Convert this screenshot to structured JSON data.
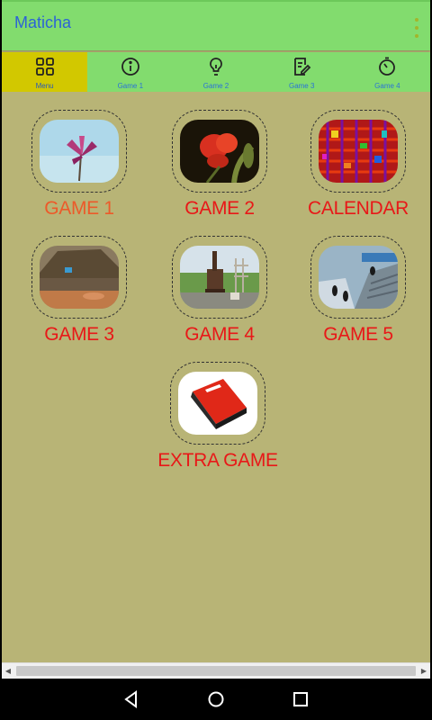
{
  "app": {
    "title": "Maticha"
  },
  "tabs": [
    {
      "label": "Menu",
      "icon": "grid-icon",
      "active": true
    },
    {
      "label": "Game 1",
      "icon": "info-icon",
      "active": false
    },
    {
      "label": "Game 2",
      "icon": "lightbulb-icon",
      "active": false
    },
    {
      "label": "Game 3",
      "icon": "edit-note-icon",
      "active": false
    },
    {
      "label": "Game 4",
      "icon": "timer-icon",
      "active": false
    }
  ],
  "tiles": [
    {
      "label": "GAME 1",
      "image": "purple-flower-image"
    },
    {
      "label": "GAME 2",
      "image": "red-flower-image"
    },
    {
      "label": "CALENDAR",
      "image": "colorful-grid-image"
    },
    {
      "label": "GAME 3",
      "image": "hut-village-image"
    },
    {
      "label": "GAME 4",
      "image": "stove-yard-image"
    },
    {
      "label": "GAME 5",
      "image": "penguins-image"
    },
    {
      "label": "EXTRA GAME",
      "image": "game-box-image"
    }
  ],
  "colors": {
    "content_bg": "#b8b476",
    "appbar_bg": "#82dc6e",
    "active_tab": "#d2c800",
    "label_red": "#e81818",
    "title_blue": "#2c63d6"
  },
  "nav": {
    "back": "back-icon",
    "home": "home-icon",
    "recents": "recents-icon"
  }
}
